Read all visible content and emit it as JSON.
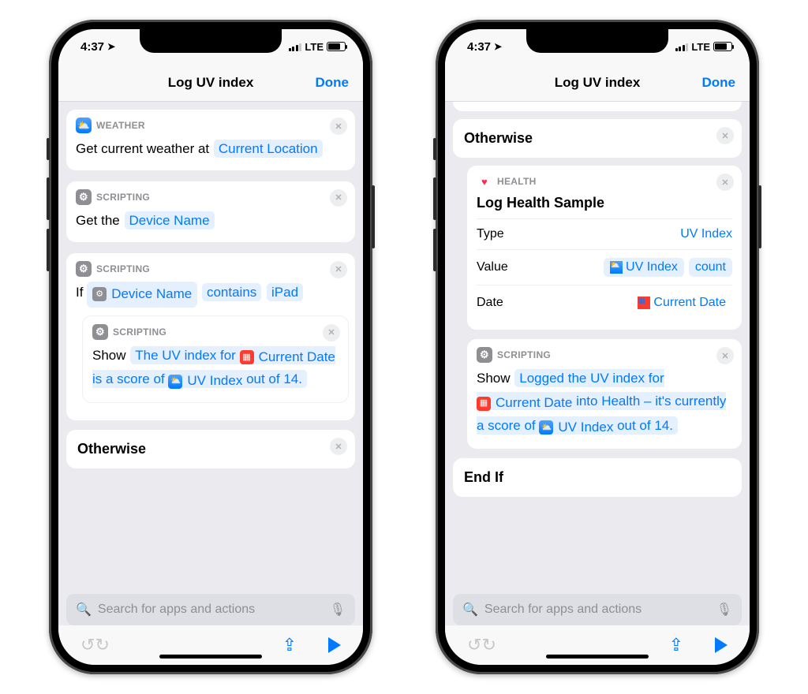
{
  "status": {
    "time": "4:37",
    "carrier": "LTE"
  },
  "nav": {
    "title": "Log UV index",
    "done": "Done"
  },
  "search": {
    "placeholder": "Search for apps and actions"
  },
  "left": {
    "weather": {
      "category": "WEATHER",
      "prefix": "Get current weather at",
      "location": "Current Location"
    },
    "getDevice": {
      "category": "SCRIPTING",
      "prefix": "Get the",
      "token": "Device Name"
    },
    "ifBlock": {
      "category": "SCRIPTING",
      "ifWord": "If",
      "subject": "Device Name",
      "condition": "contains",
      "value": "iPad"
    },
    "show": {
      "category": "SCRIPTING",
      "word": "Show",
      "t1": "The UV index for",
      "currentDate": "Current Date",
      "t2": "is a score of",
      "uvIndex": "UV Index",
      "t3": "out of 14."
    },
    "otherwise": "Otherwise"
  },
  "right": {
    "otherwise": "Otherwise",
    "health": {
      "category": "HEALTH",
      "title": "Log Health Sample",
      "rows": {
        "typeLabel": "Type",
        "typeValue": "UV Index",
        "valueLabel": "Value",
        "valueToken": "UV Index",
        "valueUnit": "count",
        "dateLabel": "Date",
        "dateValue": "Current Date"
      }
    },
    "show": {
      "category": "SCRIPTING",
      "word": "Show",
      "t1": "Logged the UV index for",
      "currentDate": "Current Date",
      "t2": "into Health – it's currently a score of",
      "uvIndex": "UV Index",
      "t3": "out of 14."
    },
    "endIf": "End If"
  }
}
